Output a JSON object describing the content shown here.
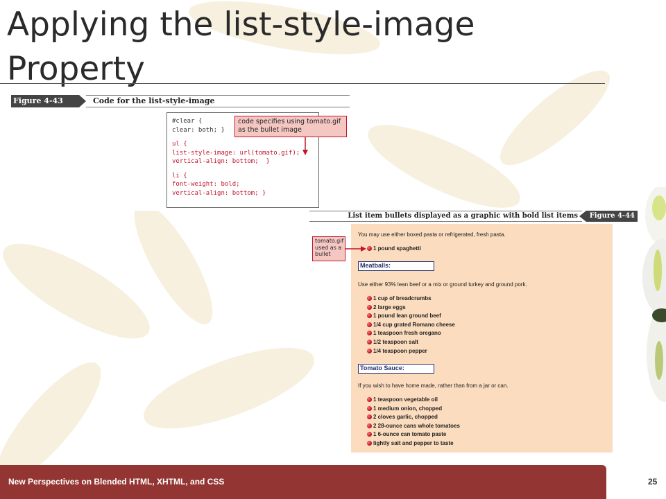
{
  "slide": {
    "title": "Applying the list-style-image Property",
    "page_number": "25",
    "footer": "New Perspectives on Blended HTML, XHTML, and CSS"
  },
  "figure_code": {
    "tag": "Figure 4-43",
    "caption": "Code for the list-style-image",
    "lines": [
      {
        "text": "#clear {",
        "style": "normal"
      },
      {
        "text": "clear: both; }",
        "style": "normal"
      },
      {
        "text": "",
        "style": "gap"
      },
      {
        "text": "ul {",
        "style": "red"
      },
      {
        "text": "list-style-image: url(tomato.gif);",
        "style": "red"
      },
      {
        "text": "vertical-align: bottom;  }",
        "style": "red"
      },
      {
        "text": "",
        "style": "gap"
      },
      {
        "text": "li {",
        "style": "red"
      },
      {
        "text": "font-weight: bold;",
        "style": "red"
      },
      {
        "text": "vertical-align: bottom; }",
        "style": "red"
      }
    ],
    "callout": "code specifies using tomato.gif as the bullet image"
  },
  "figure_browser": {
    "tag": "Figure 4-44",
    "caption": "List item bullets displayed as a graphic with bold list items",
    "callout": "tomato.gif used as a bullet",
    "intro": "You may use either boxed pasta or refrigerated, fresh pasta.",
    "first_item": "1 pound spaghetti",
    "meatballs_heading": "Meatballs:",
    "meatballs_text": "Use either 93% lean beef or a mix or ground turkey and ground pork.",
    "meatballs_items": [
      "1 cup of breadcrumbs",
      "2 large eggs",
      "1 pound lean ground beef",
      "1/4 cup grated Romano cheese",
      "1 teaspoon fresh oregano",
      "1/2 teaspoon salt",
      "1/4 teaspoon pepper"
    ],
    "sauce_heading": "Tomato Sauce:",
    "sauce_text": "If you wish to have home made, rather than from a jar or can.",
    "sauce_items": [
      "1 teaspoon vegetable oil",
      "1 medium onion, chopped",
      "2 cloves garlic, chopped",
      "2 28-ounce cans whole tomatoes",
      "1 6-ounce can tomato paste",
      "lightly salt and pepper to taste"
    ]
  },
  "colors": {
    "footer": "#933532",
    "callout_fill": "#f5c7c3",
    "accent_red": "#c0152c",
    "browser_bg": "#fbdcbe",
    "heading_blue": "#23306e"
  }
}
